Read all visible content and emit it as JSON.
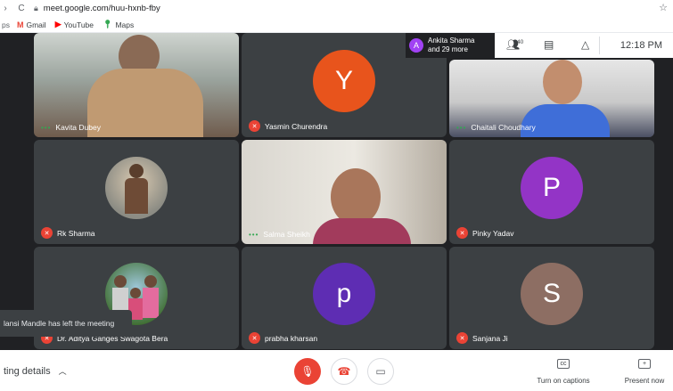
{
  "browser": {
    "url": "meet.google.com/huu-hxnb-fby",
    "bookmarks": [
      {
        "icon": "gmail-icon",
        "label": "Gmail",
        "color": "#ea4335"
      },
      {
        "icon": "youtube-icon",
        "label": "YouTube",
        "color": "#ff0000"
      },
      {
        "icon": "maps-icon",
        "label": "Maps",
        "color": "#34a853"
      }
    ],
    "bookmarks_cut": "ps"
  },
  "overlay": {
    "host_initial": "A",
    "host_name": "Ankita Sharma",
    "more": "and 29 more",
    "people_count": "40",
    "time": "12:18 PM"
  },
  "tiles": [
    {
      "name": "Kavita Dubey",
      "muted": false,
      "kind": "video"
    },
    {
      "name": "Yasmin Churendra",
      "muted": true,
      "kind": "avatar",
      "initial": "Y",
      "color": "#e8541c"
    },
    {
      "name": "Chaitali Choudhary",
      "muted": false,
      "kind": "video"
    },
    {
      "name": "Rk Sharma",
      "muted": true,
      "kind": "photo"
    },
    {
      "name": "Salma Sheikh",
      "muted": false,
      "kind": "video"
    },
    {
      "name": "Pinky Yadav",
      "muted": true,
      "kind": "avatar",
      "initial": "P",
      "color": "#9334c6"
    },
    {
      "name": "Dr. Aditya Ganges Swagota Bera",
      "muted": true,
      "kind": "photo"
    },
    {
      "name": "prabha kharsan",
      "muted": true,
      "kind": "avatar",
      "initial": "p",
      "color": "#5e2db3"
    },
    {
      "name": "Sanjana Ji",
      "muted": true,
      "kind": "avatar",
      "initial": "S",
      "color": "#8d6e63"
    }
  ],
  "toast": "lansi Mandle has left the meeting",
  "bottombar": {
    "details_label": "ting details",
    "captions_label": "Turn on captions",
    "present_label": "Present now"
  }
}
